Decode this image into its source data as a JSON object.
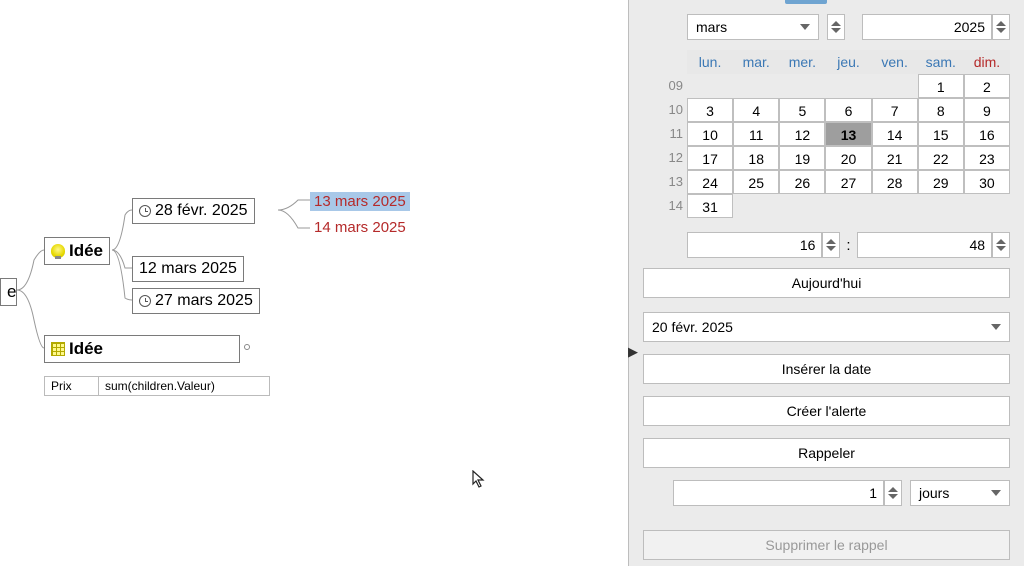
{
  "mindmap": {
    "root_label": "e",
    "idee1": "Idée",
    "idee2": "Idée",
    "child1": "28 févr. 2025",
    "child2": "12 mars 2025",
    "child3": "27 mars 2025",
    "date_sel1": "13 mars 2025",
    "date_sel2": "14 mars 2025",
    "table": {
      "col1": "Prix",
      "col2": "sum(children.Valeur)"
    }
  },
  "panel": {
    "month": "mars",
    "year": "2025",
    "weekdays": [
      "lun.",
      "mar.",
      "mer.",
      "jeu.",
      "ven.",
      "sam.",
      "dim."
    ],
    "week_numbers": [
      "09",
      "10",
      "11",
      "12",
      "13",
      "14"
    ],
    "days": [
      [
        "",
        "",
        "",
        "",
        "",
        "1",
        "2"
      ],
      [
        "3",
        "4",
        "5",
        "6",
        "7",
        "8",
        "9"
      ],
      [
        "10",
        "11",
        "12",
        "13",
        "14",
        "15",
        "16"
      ],
      [
        "17",
        "18",
        "19",
        "20",
        "21",
        "22",
        "23"
      ],
      [
        "24",
        "25",
        "26",
        "27",
        "28",
        "29",
        "30"
      ],
      [
        "31",
        "",
        "",
        "",
        "",
        "",
        ""
      ]
    ],
    "selected_day": "13",
    "hour": "16",
    "minute": "48",
    "today_label": "Aujourd'hui",
    "date_created": "20 févr. 2025",
    "insert_label": "Insérer la date",
    "create_alert": "Créer l'alerte",
    "remind_label": "Rappeler",
    "remind_value": "1",
    "remind_unit": "jours",
    "delete_remind": "Supprimer le rappel"
  }
}
